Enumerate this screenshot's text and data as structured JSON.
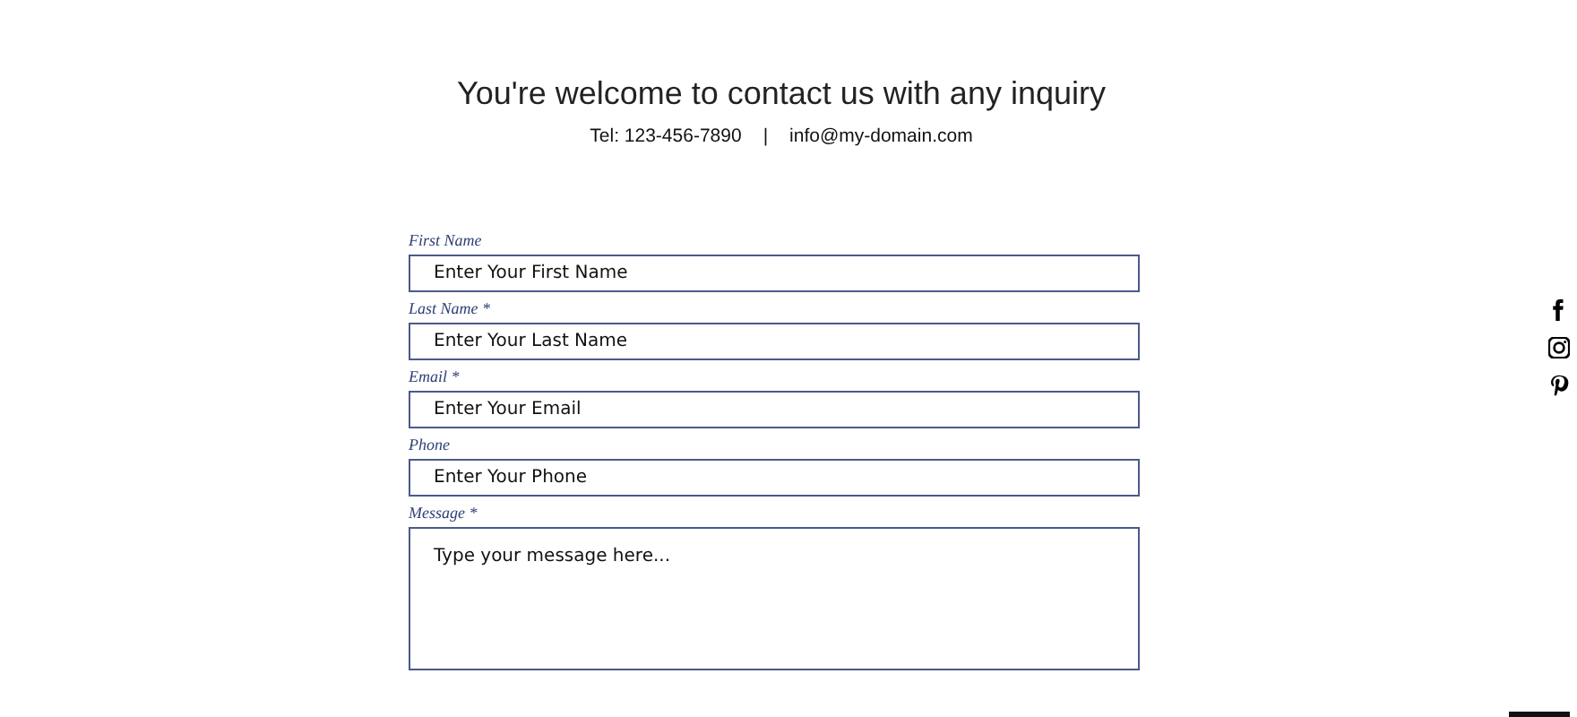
{
  "header": {
    "title": "You're welcome to contact us with any inquiry",
    "phone": "Tel: 123-456-7890",
    "separator": "|",
    "email": "info@my-domain.com"
  },
  "form": {
    "fields": [
      {
        "kind": "input",
        "label": "First Name",
        "placeholder": "Enter Your First Name"
      },
      {
        "kind": "input",
        "label": "Last Name *",
        "placeholder": "Enter Your Last Name"
      },
      {
        "kind": "input",
        "label": "Email *",
        "placeholder": "Enter Your Email"
      },
      {
        "kind": "input",
        "label": "Phone",
        "placeholder": "Enter Your Phone"
      },
      {
        "kind": "textarea",
        "label": "Message *",
        "placeholder": "Type your message here..."
      }
    ]
  },
  "social": [
    {
      "kind": "facebook"
    },
    {
      "kind": "instagram"
    },
    {
      "kind": "pinterest"
    }
  ]
}
